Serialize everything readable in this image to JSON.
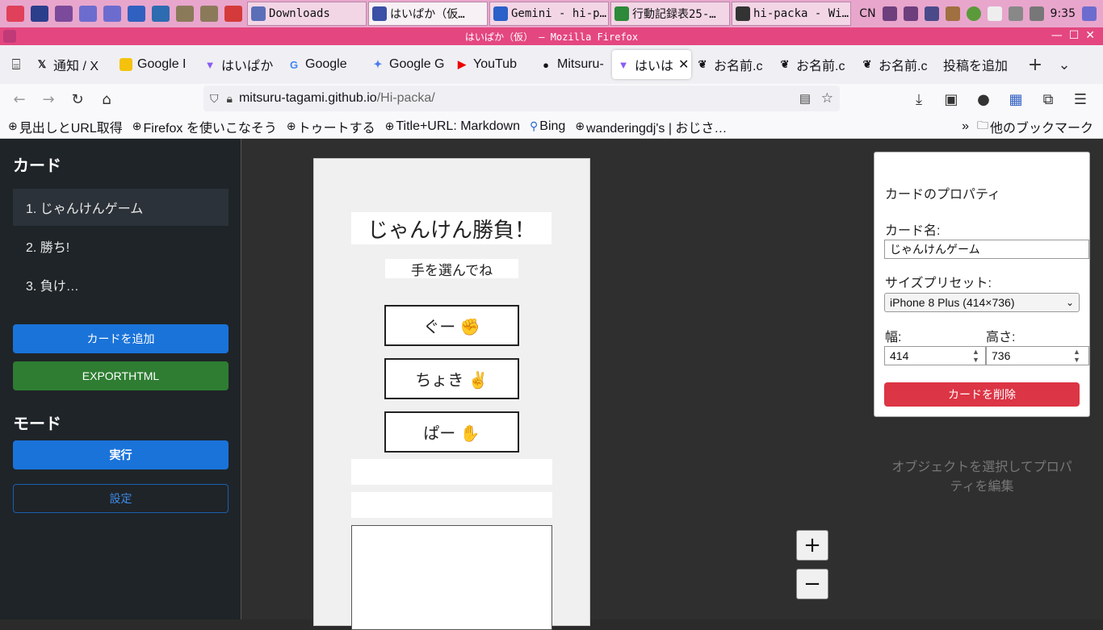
{
  "taskbar": {
    "tasks": [
      {
        "label": "Downloads",
        "color": "#5b6fb8"
      },
      {
        "label": "はいぱか（仮…",
        "color": "#3a4fa5",
        "active": true
      },
      {
        "label": "Gemini - hi-p…",
        "color": "#2a60c8"
      },
      {
        "label": "行動記録表25-…",
        "color": "#2c8a3a"
      },
      {
        "label": "hi-packa - Wi…",
        "color": "#333333"
      }
    ],
    "lang": "CN",
    "time": "9:35"
  },
  "window": {
    "title": "はいぱか（仮） — Mozilla Firefox"
  },
  "tabs": [
    {
      "label": "通知 / X",
      "icon": "x-logo-icon"
    },
    {
      "label": "Google I",
      "icon": "keep-icon"
    },
    {
      "label": "はいぱか",
      "icon": "vite-icon"
    },
    {
      "label": "Google",
      "icon": "google-icon"
    },
    {
      "label": "Google G",
      "icon": "gemini-icon"
    },
    {
      "label": "YouTub",
      "icon": "youtube-icon"
    },
    {
      "label": "Mitsuru-",
      "icon": "github-icon"
    },
    {
      "label": "はいは",
      "icon": "vite-icon",
      "selected": true
    },
    {
      "label": "お名前.c",
      "icon": "onamae-icon"
    },
    {
      "label": "お名前.c",
      "icon": "onamae-icon"
    },
    {
      "label": "お名前.c",
      "icon": "onamae-icon"
    },
    {
      "label": "投稿を追加",
      "icon": ""
    }
  ],
  "url": {
    "host": "mitsuru-tagami.github.io",
    "path": "/Hi-packa/"
  },
  "bookmarks": [
    {
      "label": "見出しとURL取得"
    },
    {
      "label": "Firefox を使いこなそう"
    },
    {
      "label": "トゥートする"
    },
    {
      "label": "Title+URL: Markdown"
    },
    {
      "label": "Bing"
    },
    {
      "label": "wanderingdj's | おじさ…"
    }
  ],
  "bookmarks_other": "他のブックマーク",
  "sidebar": {
    "cards_heading": "カード",
    "cards": [
      "1. じゃんけんゲーム",
      "2. 勝ち!",
      "3. 負け…"
    ],
    "add_card": "カードを追加",
    "export": "EXPORTHTML",
    "mode_heading": "モード",
    "run": "実行",
    "settings": "設定"
  },
  "stage": {
    "title": "じゃんけん勝負！",
    "subtitle": "手を選んでね",
    "buttons": [
      "ぐー ✊",
      "ちょき ✌",
      "ぱー ✋"
    ]
  },
  "zoom": {
    "plus": "+",
    "minus": "−"
  },
  "props": {
    "heading": "カードのプロパティ",
    "name_label": "カード名:",
    "name_value": "じゃんけんゲーム",
    "preset_label": "サイズプリセット:",
    "preset_value": "iPhone 8 Plus (414×736)",
    "width_label": "幅:",
    "width_value": "414",
    "height_label": "高さ:",
    "height_value": "736",
    "delete": "カードを削除"
  },
  "hint": "オブジェクトを選択してプロパティを編集"
}
